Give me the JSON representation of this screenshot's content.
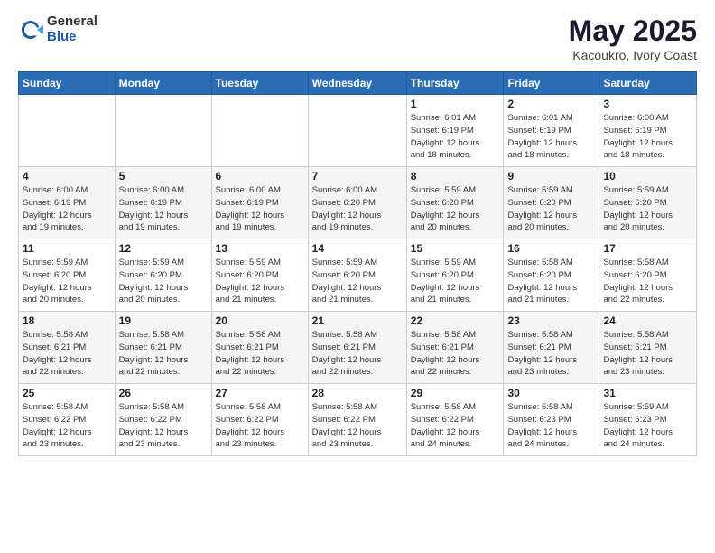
{
  "header": {
    "logo": {
      "general": "General",
      "blue": "Blue"
    },
    "title": "May 2025",
    "location": "Kacoukro, Ivory Coast"
  },
  "calendar": {
    "days_of_week": [
      "Sunday",
      "Monday",
      "Tuesday",
      "Wednesday",
      "Thursday",
      "Friday",
      "Saturday"
    ],
    "weeks": [
      {
        "days": [
          {
            "num": "",
            "info": ""
          },
          {
            "num": "",
            "info": ""
          },
          {
            "num": "",
            "info": ""
          },
          {
            "num": "",
            "info": ""
          },
          {
            "num": "1",
            "info": "Sunrise: 6:01 AM\nSunset: 6:19 PM\nDaylight: 12 hours\nand 18 minutes."
          },
          {
            "num": "2",
            "info": "Sunrise: 6:01 AM\nSunset: 6:19 PM\nDaylight: 12 hours\nand 18 minutes."
          },
          {
            "num": "3",
            "info": "Sunrise: 6:00 AM\nSunset: 6:19 PM\nDaylight: 12 hours\nand 18 minutes."
          }
        ]
      },
      {
        "days": [
          {
            "num": "4",
            "info": "Sunrise: 6:00 AM\nSunset: 6:19 PM\nDaylight: 12 hours\nand 19 minutes."
          },
          {
            "num": "5",
            "info": "Sunrise: 6:00 AM\nSunset: 6:19 PM\nDaylight: 12 hours\nand 19 minutes."
          },
          {
            "num": "6",
            "info": "Sunrise: 6:00 AM\nSunset: 6:19 PM\nDaylight: 12 hours\nand 19 minutes."
          },
          {
            "num": "7",
            "info": "Sunrise: 6:00 AM\nSunset: 6:20 PM\nDaylight: 12 hours\nand 19 minutes."
          },
          {
            "num": "8",
            "info": "Sunrise: 5:59 AM\nSunset: 6:20 PM\nDaylight: 12 hours\nand 20 minutes."
          },
          {
            "num": "9",
            "info": "Sunrise: 5:59 AM\nSunset: 6:20 PM\nDaylight: 12 hours\nand 20 minutes."
          },
          {
            "num": "10",
            "info": "Sunrise: 5:59 AM\nSunset: 6:20 PM\nDaylight: 12 hours\nand 20 minutes."
          }
        ]
      },
      {
        "days": [
          {
            "num": "11",
            "info": "Sunrise: 5:59 AM\nSunset: 6:20 PM\nDaylight: 12 hours\nand 20 minutes."
          },
          {
            "num": "12",
            "info": "Sunrise: 5:59 AM\nSunset: 6:20 PM\nDaylight: 12 hours\nand 20 minutes."
          },
          {
            "num": "13",
            "info": "Sunrise: 5:59 AM\nSunset: 6:20 PM\nDaylight: 12 hours\nand 21 minutes."
          },
          {
            "num": "14",
            "info": "Sunrise: 5:59 AM\nSunset: 6:20 PM\nDaylight: 12 hours\nand 21 minutes."
          },
          {
            "num": "15",
            "info": "Sunrise: 5:59 AM\nSunset: 6:20 PM\nDaylight: 12 hours\nand 21 minutes."
          },
          {
            "num": "16",
            "info": "Sunrise: 5:58 AM\nSunset: 6:20 PM\nDaylight: 12 hours\nand 21 minutes."
          },
          {
            "num": "17",
            "info": "Sunrise: 5:58 AM\nSunset: 6:20 PM\nDaylight: 12 hours\nand 22 minutes."
          }
        ]
      },
      {
        "days": [
          {
            "num": "18",
            "info": "Sunrise: 5:58 AM\nSunset: 6:21 PM\nDaylight: 12 hours\nand 22 minutes."
          },
          {
            "num": "19",
            "info": "Sunrise: 5:58 AM\nSunset: 6:21 PM\nDaylight: 12 hours\nand 22 minutes."
          },
          {
            "num": "20",
            "info": "Sunrise: 5:58 AM\nSunset: 6:21 PM\nDaylight: 12 hours\nand 22 minutes."
          },
          {
            "num": "21",
            "info": "Sunrise: 5:58 AM\nSunset: 6:21 PM\nDaylight: 12 hours\nand 22 minutes."
          },
          {
            "num": "22",
            "info": "Sunrise: 5:58 AM\nSunset: 6:21 PM\nDaylight: 12 hours\nand 22 minutes."
          },
          {
            "num": "23",
            "info": "Sunrise: 5:58 AM\nSunset: 6:21 PM\nDaylight: 12 hours\nand 23 minutes."
          },
          {
            "num": "24",
            "info": "Sunrise: 5:58 AM\nSunset: 6:21 PM\nDaylight: 12 hours\nand 23 minutes."
          }
        ]
      },
      {
        "days": [
          {
            "num": "25",
            "info": "Sunrise: 5:58 AM\nSunset: 6:22 PM\nDaylight: 12 hours\nand 23 minutes."
          },
          {
            "num": "26",
            "info": "Sunrise: 5:58 AM\nSunset: 6:22 PM\nDaylight: 12 hours\nand 23 minutes."
          },
          {
            "num": "27",
            "info": "Sunrise: 5:58 AM\nSunset: 6:22 PM\nDaylight: 12 hours\nand 23 minutes."
          },
          {
            "num": "28",
            "info": "Sunrise: 5:58 AM\nSunset: 6:22 PM\nDaylight: 12 hours\nand 23 minutes."
          },
          {
            "num": "29",
            "info": "Sunrise: 5:58 AM\nSunset: 6:22 PM\nDaylight: 12 hours\nand 24 minutes."
          },
          {
            "num": "30",
            "info": "Sunrise: 5:58 AM\nSunset: 6:23 PM\nDaylight: 12 hours\nand 24 minutes."
          },
          {
            "num": "31",
            "info": "Sunrise: 5:59 AM\nSunset: 6:23 PM\nDaylight: 12 hours\nand 24 minutes."
          }
        ]
      }
    ]
  }
}
